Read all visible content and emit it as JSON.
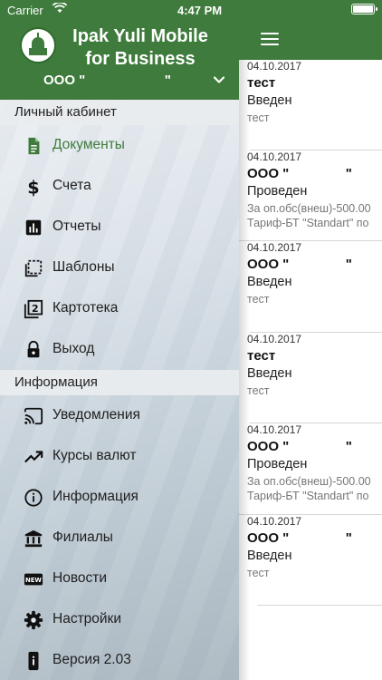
{
  "status_bar": {
    "carrier": "Carrier",
    "time": "4:47 PM"
  },
  "header": {
    "app_title_line1": "Ipak Yuli Mobile",
    "app_title_line2": "for Business",
    "company": "ООО \"                     \""
  },
  "sections": {
    "personal": "Личный кабинет",
    "info": "Информация"
  },
  "menu_personal": [
    {
      "label": "Документы",
      "icon": "document-icon",
      "active": true
    },
    {
      "label": "Счета",
      "icon": "dollar-icon"
    },
    {
      "label": "Отчеты",
      "icon": "bar-chart-icon"
    },
    {
      "label": "Шаблоны",
      "icon": "templates-icon"
    },
    {
      "label": "Картотека",
      "icon": "file-index-icon"
    },
    {
      "label": "Выход",
      "icon": "lock-icon"
    }
  ],
  "menu_info": [
    {
      "label": "Уведомления",
      "icon": "cast-icon"
    },
    {
      "label": "Курсы валют",
      "icon": "trending-up-icon"
    },
    {
      "label": "Информация",
      "icon": "info-icon"
    },
    {
      "label": "Филиалы",
      "icon": "bank-icon"
    },
    {
      "label": "Новости",
      "icon": "new-badge-icon"
    },
    {
      "label": "Настройки",
      "icon": "settings-gear-icon"
    },
    {
      "label": "Версия 2.03",
      "icon": "device-info-icon"
    }
  ],
  "documents": [
    {
      "date": "04.10.2017",
      "title": "тест",
      "state": "Введен",
      "notes": [
        "тест"
      ]
    },
    {
      "date": "04.10.2017",
      "title": "ООО \"               \"",
      "state": "Проведен",
      "notes": [
        "За оп.обс(внеш)-500.00",
        "Тариф-БТ \"Standart\" по"
      ]
    },
    {
      "date": "04.10.2017",
      "title": "ООО \"               \"",
      "state": "Введен",
      "notes": [
        "тест"
      ]
    },
    {
      "date": "04.10.2017",
      "title": "тест",
      "state": "Введен",
      "notes": [
        "тест"
      ]
    },
    {
      "date": "04.10.2017",
      "title": "ООО \"               \"",
      "state": "Проведен",
      "notes": [
        "За оп.обс(внеш)-500.00",
        "Тариф-БТ \"Standart\" по"
      ]
    },
    {
      "date": "04.10.2017",
      "title": "ООО \"               \"",
      "state": "Введен",
      "notes": [
        "тест"
      ]
    }
  ],
  "colors": {
    "brand_green": "#3e7b3c",
    "active_text": "#3e7b3c"
  }
}
